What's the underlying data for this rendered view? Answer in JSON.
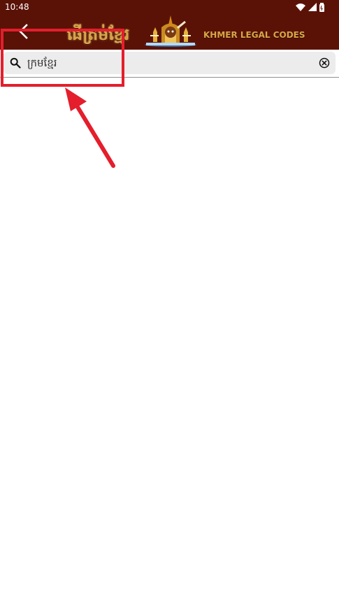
{
  "status_bar": {
    "time": "10:48",
    "icons": [
      "wifi-icon",
      "signal-icon",
      "battery-icon"
    ]
  },
  "header": {
    "back_icon": "back-arrow-icon",
    "title_khmer": "ផើត្រម់ខ្មែរ",
    "logo": "khmer-legal-codes-logo",
    "title_english": "KHMER LEGAL CODES"
  },
  "search": {
    "value": "ក្រមខ្មែរ",
    "icon": "search-icon",
    "clear_icon": "clear-icon"
  },
  "colors": {
    "header_background": "#5a1207",
    "title_gold": "#d8a64a",
    "search_background": "#ececec",
    "annotation_red": "#e41e2c"
  }
}
